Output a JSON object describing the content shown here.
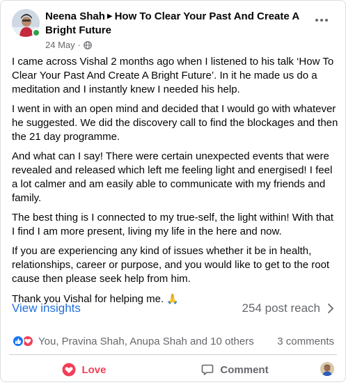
{
  "post": {
    "author": "Neena Shah",
    "target": "How To Clear Your Past And Create A Bright Future",
    "date": "24 May",
    "separator": "·",
    "paragraphs": [
      "I came across Vishal 2 months ago when I listened to his talk ‘How To Clear Your Past And Create A Bright Future’. In it he made us do a meditation and I instantly knew I needed his help.",
      "I went in with an open mind and decided that I would go with whatever he suggested. We did the discovery call to find the blockages and then the 21 day programme.",
      "And what can I say! There were certain unexpected events that were revealed and  released which left me feeling light and energised! I feel a lot calmer and am easily able to communicate with my friends and family.",
      "The best thing is I connected to my true-self, the light within! With that I find I am more present, living my life in the here and now.",
      "If you are experiencing any kind of issues whether it be in health, relationships, career or purpose, and you would like to get to the root cause then please seek help from him."
    ],
    "closing": "Thank you Vishal for helping me.",
    "closing_emoji": "🙏"
  },
  "insights": {
    "link_label": "View insights",
    "reach_label": "254 post reach"
  },
  "reactions": {
    "names": "You, Pravina Shah, Anupa Shah and 10 others",
    "comments": "3 comments"
  },
  "actions": {
    "love_label": "Love",
    "comment_label": "Comment"
  },
  "colors": {
    "brand_blue": "#1877f2",
    "love_red": "#f33e58",
    "online_green": "#31a24c",
    "secondary_text": "#65676b"
  },
  "icons": [
    "avatar",
    "online-status-icon",
    "audience-globe-icon",
    "more-options-icon",
    "chevron-right-icon",
    "like-reaction-icon",
    "love-reaction-icon",
    "love-heart-icon",
    "comment-bubble-icon",
    "profile-switcher-avatar"
  ]
}
